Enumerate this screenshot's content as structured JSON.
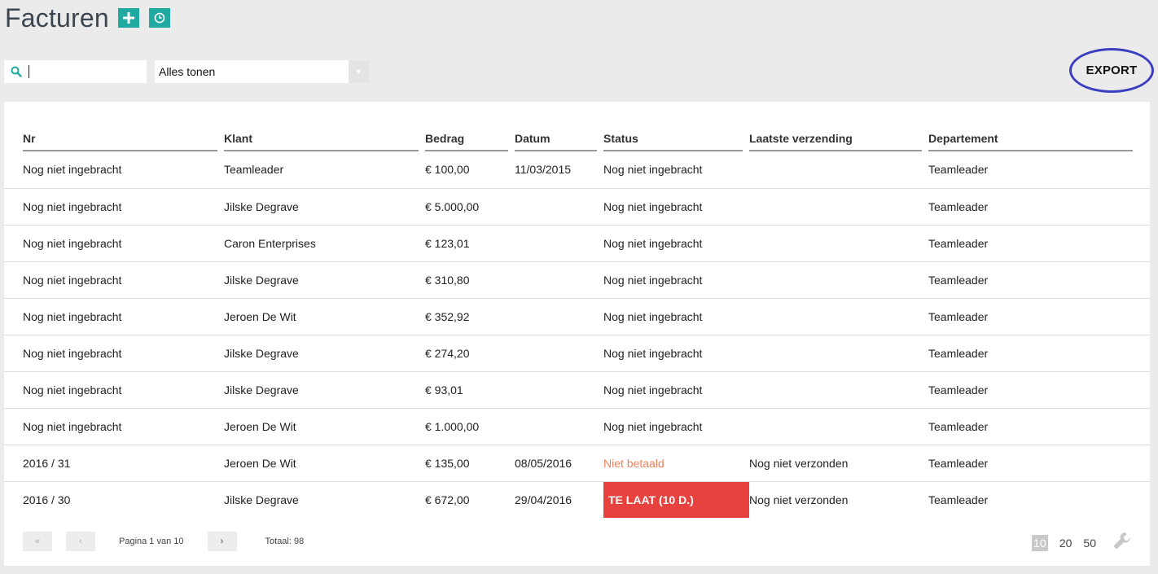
{
  "header": {
    "title": "Facturen",
    "add_icon": "plus-icon",
    "history_icon": "clock-icon"
  },
  "search": {
    "value": "",
    "placeholder": "",
    "icon": "search-icon"
  },
  "filter": {
    "selected": "Alles tonen"
  },
  "export": {
    "label": "EXPORT"
  },
  "table": {
    "columns": [
      "Nr",
      "Klant",
      "Bedrag",
      "Datum",
      "Status",
      "Laatste verzending",
      "Departement"
    ],
    "rows": [
      [
        "Nog niet ingebracht",
        "Teamleader",
        "€ 100,00",
        "11/03/2015",
        "Nog niet ingebracht",
        "",
        "Teamleader"
      ],
      [
        "Nog niet ingebracht",
        "Jilske Degrave",
        "€ 5.000,00",
        "",
        "Nog niet ingebracht",
        "",
        "Teamleader"
      ],
      [
        "Nog niet ingebracht",
        "Caron Enterprises",
        "€ 123,01",
        "",
        "Nog niet ingebracht",
        "",
        "Teamleader"
      ],
      [
        "Nog niet ingebracht",
        "Jilske Degrave",
        "€ 310,80",
        "",
        "Nog niet ingebracht",
        "",
        "Teamleader"
      ],
      [
        "Nog niet ingebracht",
        "Jeroen De Wit",
        "€ 352,92",
        "",
        "Nog niet ingebracht",
        "",
        "Teamleader"
      ],
      [
        "Nog niet ingebracht",
        "Jilske Degrave",
        "€ 274,20",
        "",
        "Nog niet ingebracht",
        "",
        "Teamleader"
      ],
      [
        "Nog niet ingebracht",
        "Jilske Degrave",
        "€ 93,01",
        "",
        "Nog niet ingebracht",
        "",
        "Teamleader"
      ],
      [
        "Nog niet ingebracht",
        "Jeroen De Wit",
        "€ 1.000,00",
        "",
        "Nog niet ingebracht",
        "",
        "Teamleader"
      ],
      [
        "2016 / 31",
        "Jeroen De Wit",
        "€ 135,00",
        "08/05/2016",
        "Niet betaald",
        "Nog niet verzonden",
        "Teamleader"
      ],
      [
        "2016 / 30",
        "Jilske Degrave",
        "€ 672,00",
        "29/04/2016",
        "TE LAAT (10 D.)",
        "Nog niet verzonden",
        "Teamleader"
      ]
    ],
    "status_styles": [
      "normal",
      "normal",
      "normal",
      "normal",
      "normal",
      "normal",
      "normal",
      "normal",
      "unpaid",
      "late"
    ]
  },
  "pagination": {
    "first": "«",
    "prev": "‹",
    "next": "›",
    "info": "Pagina 1 van 10",
    "total": "Totaal: 98"
  },
  "page_sizes": {
    "options": [
      "10",
      "20",
      "50"
    ],
    "selected": "10",
    "settings_icon": "wrench-icon"
  },
  "colors": {
    "accent": "#1fa9a0",
    "late": "#e8423f",
    "unpaid": "#f0825a",
    "highlight_ring": "#3b3fc0"
  }
}
